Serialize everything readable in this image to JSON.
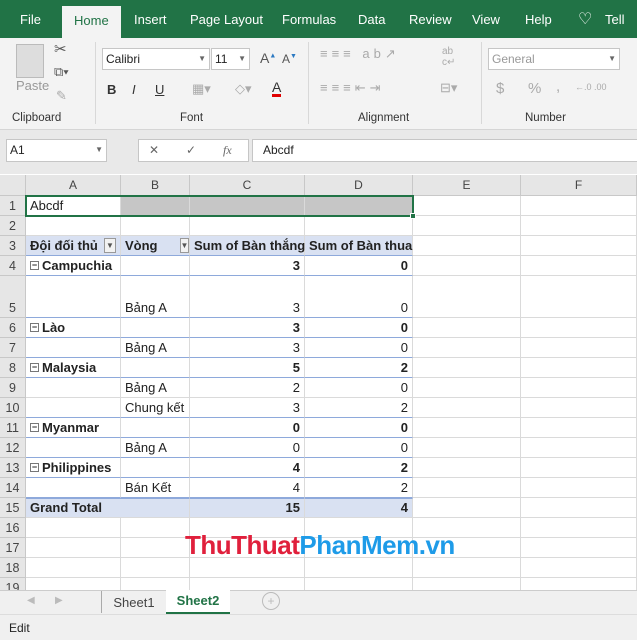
{
  "ribbon_tabs": [
    "File",
    "Home",
    "Insert",
    "Page Layout",
    "Formulas",
    "Data",
    "Review",
    "View",
    "Help"
  ],
  "tell_me": "Tell m",
  "active_tab": "Home",
  "clipboard": {
    "paste": "Paste",
    "label": "Clipboard"
  },
  "font": {
    "name": "Calibri",
    "size": "11",
    "label": "Font",
    "bold": "B",
    "italic": "I",
    "underline": "U",
    "font_color": "#e00000"
  },
  "alignment": {
    "label": "Alignment"
  },
  "number": {
    "format": "General",
    "label": "Number",
    "currency": "$",
    "percent": "%",
    "comma": ","
  },
  "formula_bar": {
    "name_box": "A1",
    "cancel": "✕",
    "enter": "✓",
    "fx": "fx",
    "value": "Abcdf"
  },
  "columns": [
    "A",
    "B",
    "C",
    "D",
    "E",
    "F"
  ],
  "a1_value": "Abcdf",
  "pivot": {
    "headers": [
      "Đội đối thủ",
      "Vòng",
      "Sum of Bàn thắng",
      "Sum of Bàn thua"
    ],
    "rows": [
      {
        "row": "4",
        "team": "Campuchia",
        "goals_for": "3",
        "goals_against": "0"
      },
      {
        "row": "5",
        "round": "Bảng A",
        "goals_for": "3",
        "goals_against": "0"
      },
      {
        "row": "6",
        "team": "Lào",
        "goals_for": "3",
        "goals_against": "0"
      },
      {
        "row": "7",
        "round": "Bảng A",
        "goals_for": "3",
        "goals_against": "0"
      },
      {
        "row": "8",
        "team": "Malaysia",
        "goals_for": "5",
        "goals_against": "2"
      },
      {
        "row": "9",
        "round": "Bảng A",
        "goals_for": "2",
        "goals_against": "0"
      },
      {
        "row": "10",
        "round": "Chung kết",
        "goals_for": "3",
        "goals_against": "2"
      },
      {
        "row": "11",
        "team": "Myanmar",
        "goals_for": "0",
        "goals_against": "0"
      },
      {
        "row": "12",
        "round": "Bảng A",
        "goals_for": "0",
        "goals_against": "0"
      },
      {
        "row": "13",
        "team": "Philippines",
        "goals_for": "4",
        "goals_against": "2"
      },
      {
        "row": "14",
        "round": "Bán Kết",
        "goals_for": "4",
        "goals_against": "2"
      }
    ],
    "grand_total": {
      "label": "Grand Total",
      "goals_for": "15",
      "goals_against": "4"
    }
  },
  "row_numbers": [
    "1",
    "2",
    "3",
    "4",
    "5",
    "6",
    "7",
    "8",
    "9",
    "10",
    "11",
    "12",
    "13",
    "14",
    "15",
    "16",
    "17",
    "18",
    "19"
  ],
  "watermark": {
    "part1": "ThuThuat",
    "part2": "PhanMem.vn",
    "color1": "#e0203c",
    "color2": "#1e9be8"
  },
  "sheets": [
    "Sheet1",
    "Sheet2"
  ],
  "active_sheet": "Sheet2",
  "status": "Edit",
  "colors": {
    "brand": "#217346",
    "pivot_header": "#d9e1f2"
  }
}
